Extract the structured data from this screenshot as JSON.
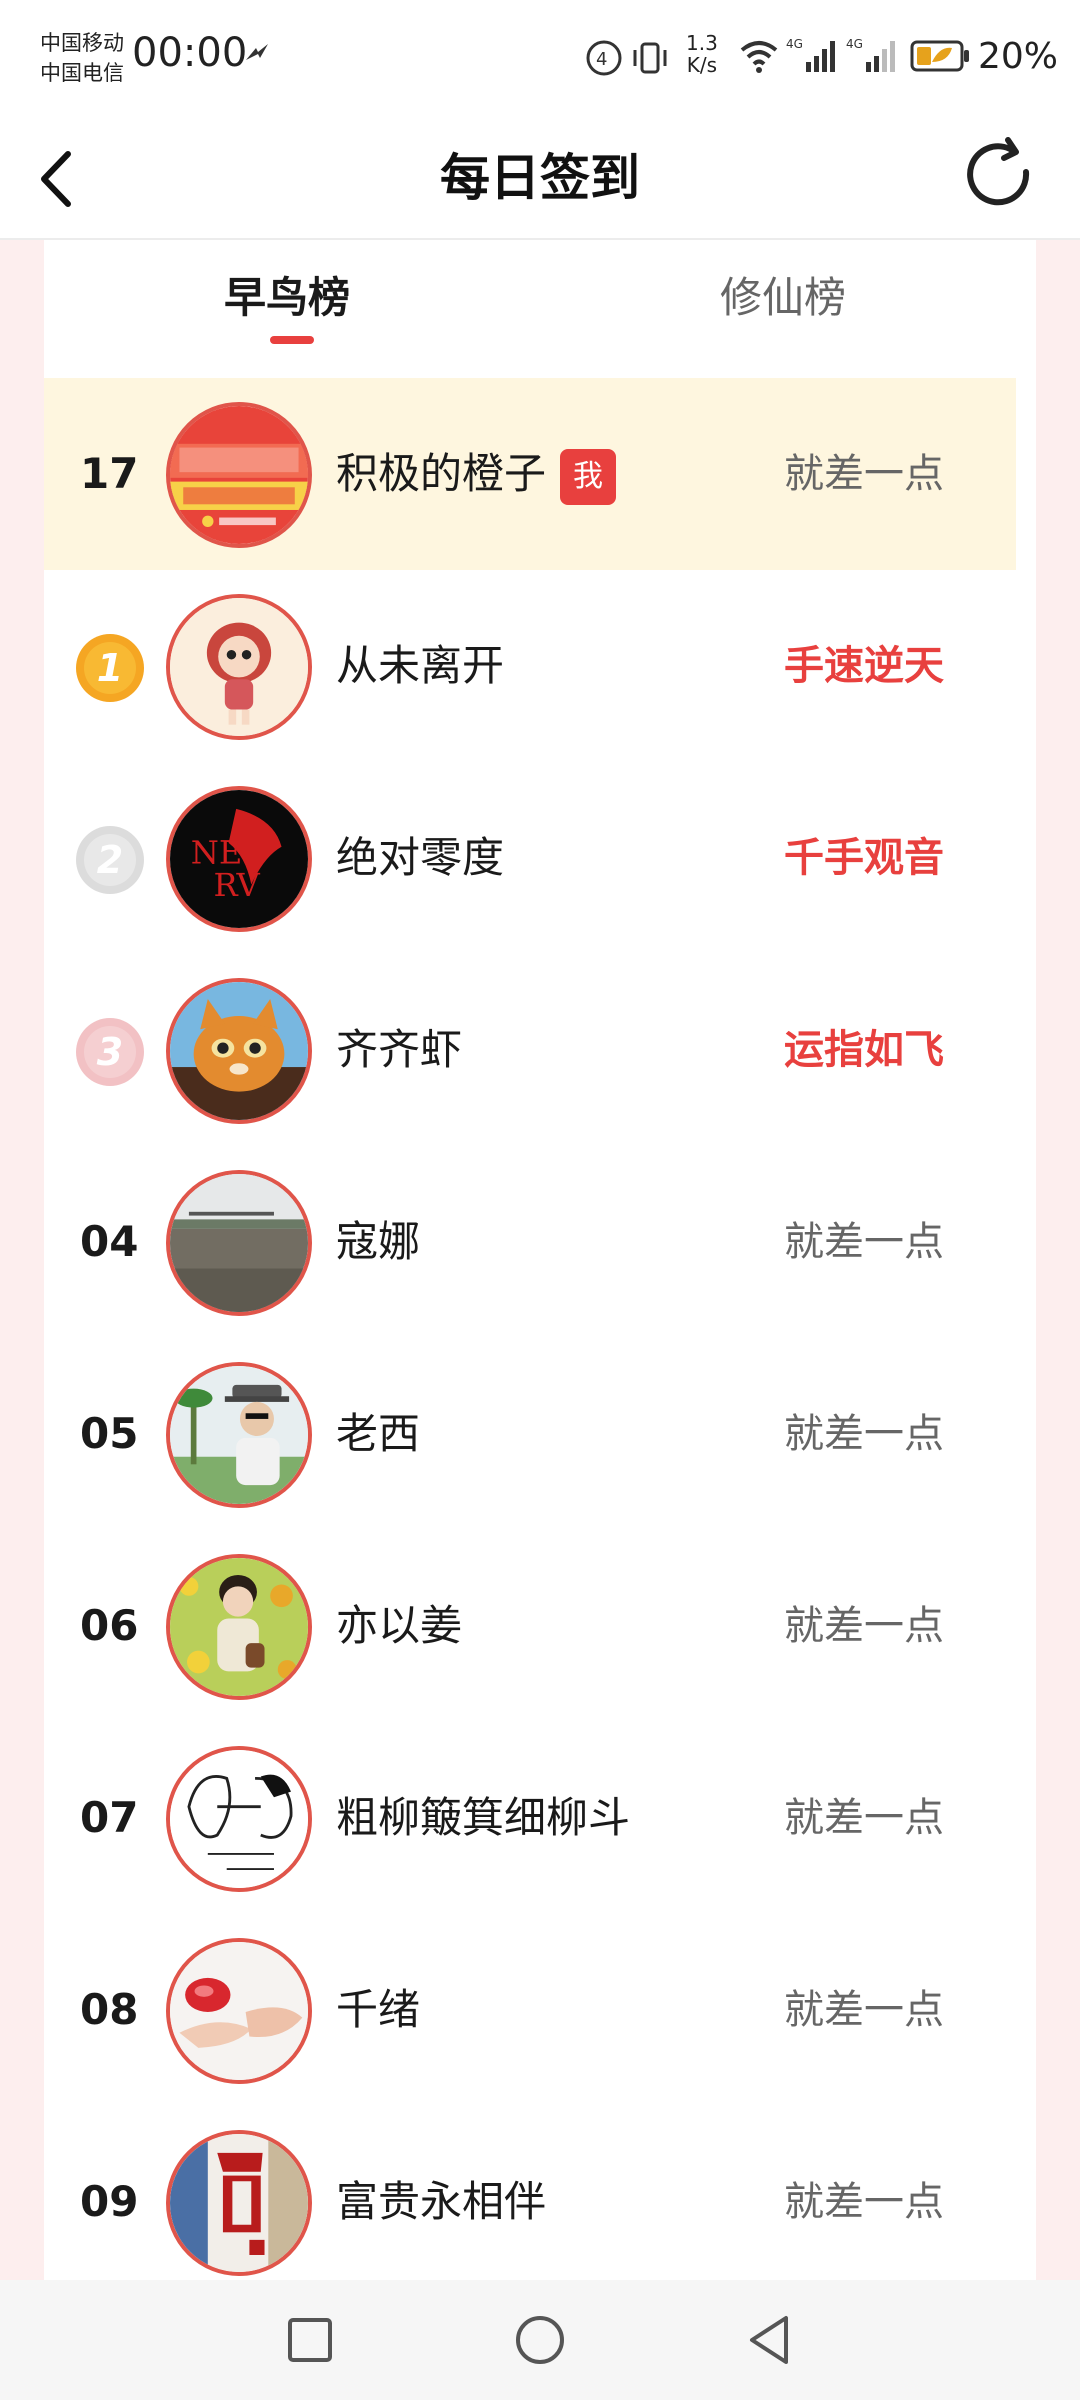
{
  "status_bar": {
    "carrier1": "中国移动",
    "carrier2": "中国电信",
    "time": "00:00",
    "speed_value": "1.3",
    "speed_unit": "K/s",
    "battery": "20%"
  },
  "header": {
    "title": "每日签到"
  },
  "tabs": [
    {
      "label": "早鸟榜",
      "active": true
    },
    {
      "label": "修仙榜",
      "active": false
    }
  ],
  "me": {
    "rank": "17",
    "name": "积极的橙子",
    "badge": "我",
    "status": "就差一点"
  },
  "ranking": [
    {
      "rank": "1",
      "name": "从未离开",
      "status": "手速逆天"
    },
    {
      "rank": "2",
      "name": "绝对零度",
      "status": "千手观音"
    },
    {
      "rank": "3",
      "name": "齐齐虾",
      "status": "运指如飞"
    },
    {
      "rank": "04",
      "name": "寇娜",
      "status": "就差一点"
    },
    {
      "rank": "05",
      "name": "老西",
      "status": "就差一点"
    },
    {
      "rank": "06",
      "name": "亦以姜",
      "status": "就差一点"
    },
    {
      "rank": "07",
      "name": "粗柳簸箕细柳斗",
      "status": "就差一点"
    },
    {
      "rank": "08",
      "name": "千绪",
      "status": "就差一点"
    },
    {
      "rank": "09",
      "name": "富贵永相伴",
      "status": "就差一点"
    }
  ],
  "colors": {
    "accent": "#e8403e",
    "highlight_row": "#fef6df",
    "side_bg": "#fdeeee"
  }
}
